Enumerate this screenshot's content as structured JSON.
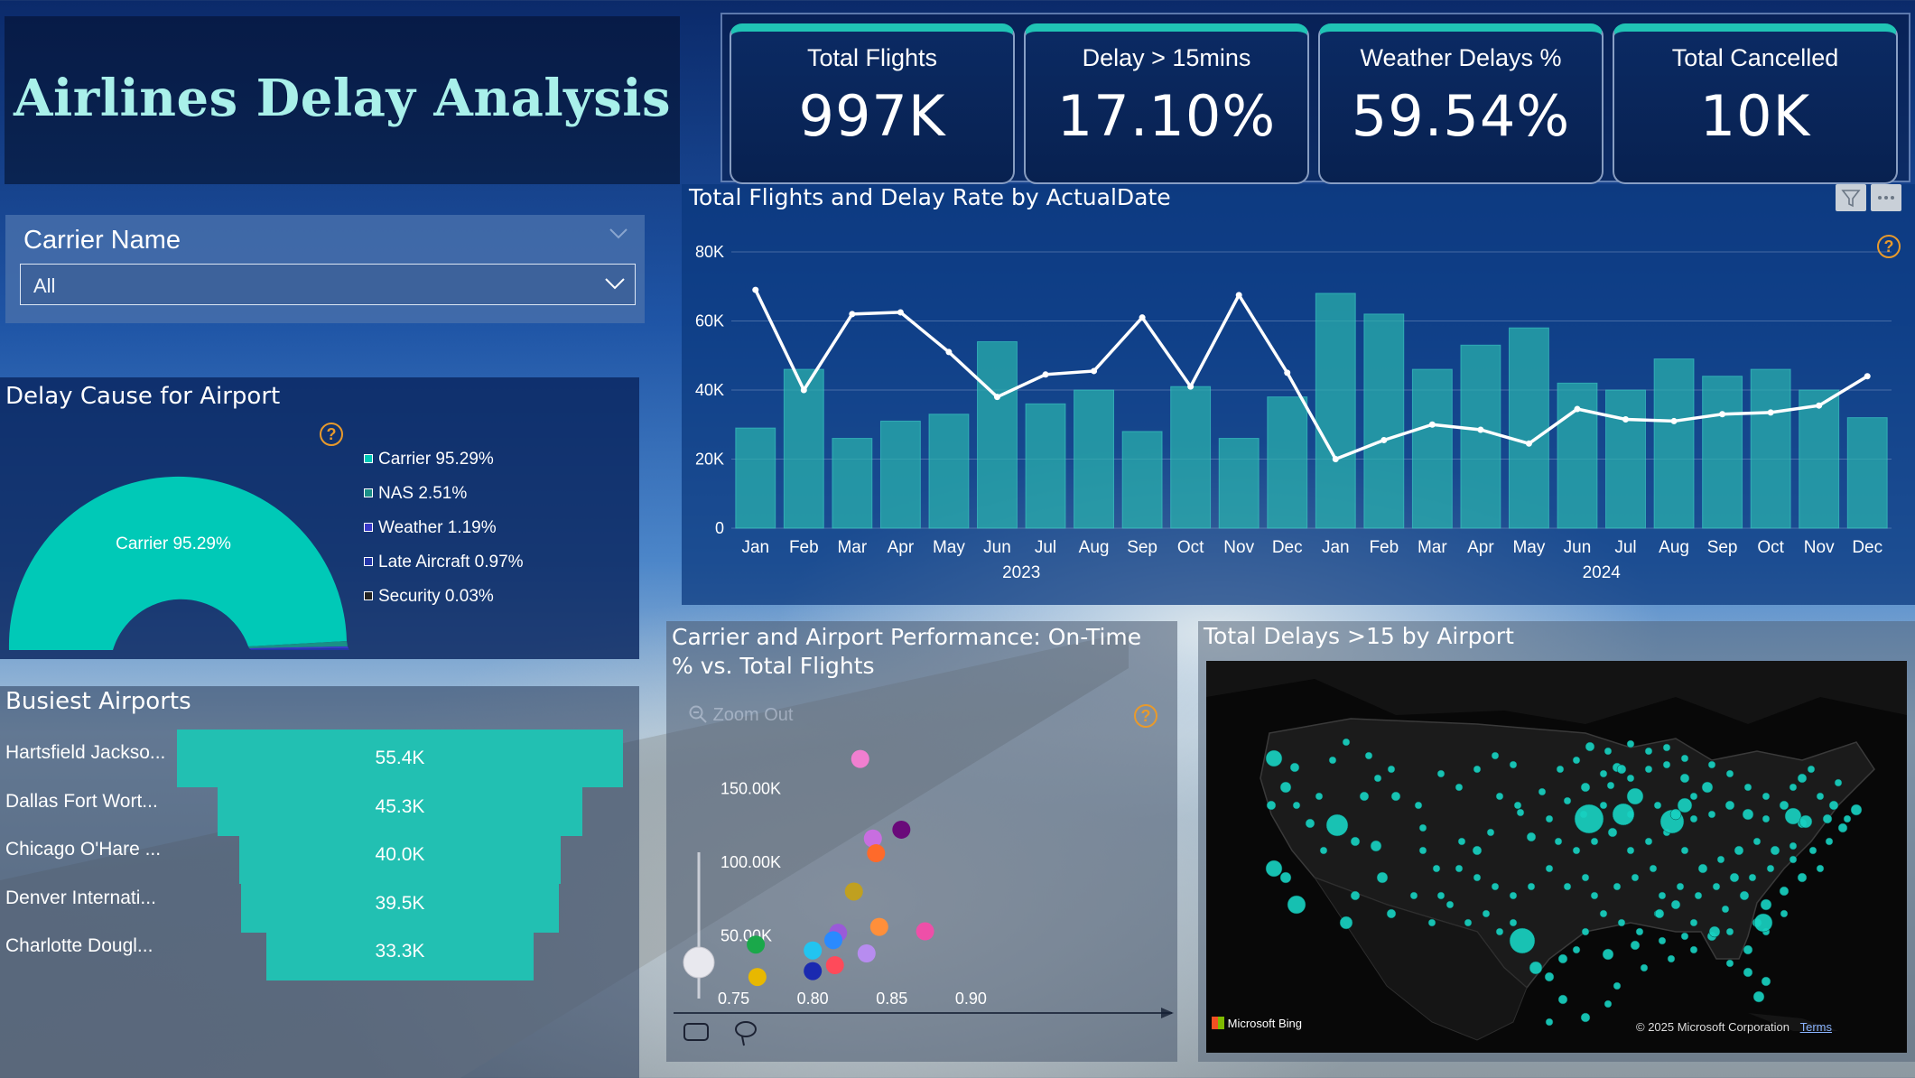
{
  "header": {
    "title": "Airlines Delay Analysis"
  },
  "kpis": [
    {
      "label": "Total Flights",
      "value": "997K"
    },
    {
      "label": "Delay > 15mins",
      "value": "17.10%"
    },
    {
      "label": "Weather Delays %",
      "value": "59.54%"
    },
    {
      "label": "Total Cancelled",
      "value": "10K"
    }
  ],
  "slicer": {
    "title": "Carrier Name",
    "selected": "All"
  },
  "delay_cause": {
    "title": "Delay Cause for Airport",
    "center_label": "Carrier 95.29%",
    "legend": [
      {
        "label": "Carrier 95.29%",
        "value": 95.29,
        "color": "#00c9b7"
      },
      {
        "label": "NAS 2.51%",
        "value": 2.51,
        "color": "#1a8f86"
      },
      {
        "label": "Weather 1.19%",
        "value": 1.19,
        "color": "#3a3ac9"
      },
      {
        "label": "Late Aircraft 0.97%",
        "value": 0.97,
        "color": "#2436a8"
      },
      {
        "label": "Security 0.03%",
        "value": 0.03,
        "color": "#222222"
      }
    ]
  },
  "busiest": {
    "title": "Busiest Airports",
    "rows": [
      {
        "label": "Hartsfield Jackso...",
        "value": 55.4,
        "text": "55.4K"
      },
      {
        "label": "Dallas Fort Wort...",
        "value": 45.3,
        "text": "45.3K"
      },
      {
        "label": "Chicago O'Hare ...",
        "value": 40.0,
        "text": "40.0K"
      },
      {
        "label": "Denver Internati...",
        "value": 39.5,
        "text": "39.5K"
      },
      {
        "label": "Charlotte Dougl...",
        "value": 33.3,
        "text": "33.3K"
      }
    ]
  },
  "line_chart": {
    "title": "Total Flights and Delay Rate by ActualDate",
    "chart_data": {
      "type": "bar",
      "categories": [
        "Jan",
        "Feb",
        "Mar",
        "Apr",
        "May",
        "Jun",
        "Jul",
        "Aug",
        "Sep",
        "Oct",
        "Nov",
        "Dec",
        "Jan",
        "Feb",
        "Mar",
        "Apr",
        "May",
        "Jun",
        "Jul",
        "Aug",
        "Sep",
        "Oct",
        "Nov",
        "Dec"
      ],
      "years": [
        {
          "label": "2023",
          "span": [
            0,
            11
          ]
        },
        {
          "label": "2024",
          "span": [
            12,
            23
          ]
        }
      ],
      "y_ticks": [
        "0",
        "20K",
        "40K",
        "60K",
        "80K"
      ],
      "ylim": [
        0,
        80000
      ],
      "series": [
        {
          "values": [
            29000,
            46000,
            26000,
            31000,
            33000,
            54000,
            36000,
            40000,
            28000,
            41000,
            26000,
            38000,
            68000,
            62000,
            46000,
            53000,
            58000,
            42000,
            40000,
            49000,
            44000,
            46000,
            40000,
            32000
          ]
        },
        {
          "values": [
            69000,
            40000,
            62000,
            62500,
            51000,
            38000,
            44500,
            45500,
            61000,
            41000,
            67500,
            45000,
            20000,
            25500,
            30000,
            28500,
            24500,
            34500,
            31500,
            31000,
            33000,
            33500,
            35500,
            44000
          ]
        }
      ],
      "colors": {
        "bar": "#2ab3ad",
        "line": "#ffffff"
      }
    }
  },
  "scatter": {
    "title_line1": "Carrier and Airport Performance: On-Time",
    "title_line2": "% vs. Total Flights",
    "zoom_out": "Zoom Out",
    "chart_data": {
      "type": "scatter",
      "x_ticks": [
        "0.75",
        "0.80",
        "0.85",
        "0.90"
      ],
      "y_ticks": [
        "50.00K",
        "100.00K",
        "150.00K"
      ],
      "xlim": [
        0.72,
        0.93
      ],
      "ylim": [
        0,
        190000
      ],
      "points": [
        {
          "x": 0.83,
          "y": 170000,
          "color": "#f07fd0"
        },
        {
          "x": 0.856,
          "y": 122000,
          "color": "#6a0a7a"
        },
        {
          "x": 0.838,
          "y": 116000,
          "color": "#c86ee0"
        },
        {
          "x": 0.84,
          "y": 106000,
          "color": "#ff6a2a"
        },
        {
          "x": 0.826,
          "y": 80000,
          "color": "#c0a020"
        },
        {
          "x": 0.842,
          "y": 56000,
          "color": "#ff8f3a"
        },
        {
          "x": 0.871,
          "y": 53000,
          "color": "#ee4fa8"
        },
        {
          "x": 0.816,
          "y": 52000,
          "color": "#9a5ad8"
        },
        {
          "x": 0.813,
          "y": 47000,
          "color": "#2a8aff"
        },
        {
          "x": 0.8,
          "y": 40000,
          "color": "#22c4f0"
        },
        {
          "x": 0.834,
          "y": 38000,
          "color": "#b78cf0"
        },
        {
          "x": 0.814,
          "y": 30000,
          "color": "#ff4a5a"
        },
        {
          "x": 0.8,
          "y": 26000,
          "color": "#1a2ab0"
        },
        {
          "x": 0.764,
          "y": 44000,
          "color": "#1aa84a"
        },
        {
          "x": 0.765,
          "y": 22000,
          "color": "#e8b800"
        }
      ]
    }
  },
  "map": {
    "title": "Total Delays >15 by Airport",
    "attribution_logo": "Microsoft Bing",
    "copyright": "© 2025 Microsoft Corporation",
    "terms": "Terms",
    "bubble_color": "#18d0c0"
  }
}
